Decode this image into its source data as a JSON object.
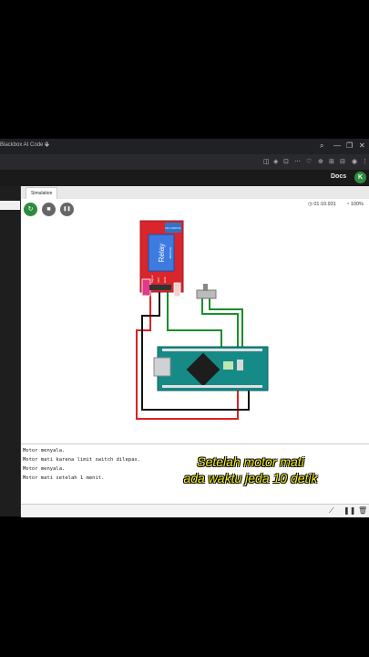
{
  "tab": {
    "title": "Blackbox AI Code G",
    "new_tab": "+"
  },
  "window_controls": {
    "search": "⌕",
    "minimize": "—",
    "restore": "❐",
    "close": "✕"
  },
  "toolbar_icons": [
    "◫",
    "◈",
    "⊡",
    "⋯",
    "♡",
    "⊕",
    "⊞",
    "⊟",
    "◉",
    "⋮"
  ],
  "app": {
    "docs_label": "Docs",
    "avatar_letter": "K"
  },
  "sim": {
    "tab_label": "Simulation",
    "timer": "01:10.931",
    "performance": "100%",
    "controls": {
      "restart": "↻",
      "stop": "■",
      "pause": "❚❚"
    }
  },
  "relay": {
    "label": "Relay",
    "sublabel": "MODULE",
    "top_pins": "NO COM NC",
    "side_pins": [
      "Signal",
      "VCC",
      "GND"
    ]
  },
  "board": {
    "name": "Arduino Nano"
  },
  "serial": {
    "lines": [
      "Motor menyala.",
      "Motor mati karena limit switch dilepas.",
      "Motor menyala.",
      "Motor mati setelah 1 menit."
    ]
  },
  "caption": [
    "Setelah motor mati",
    "ada waktu jeda 10 detik"
  ],
  "colors": {
    "accent_green": "#2e8b3e",
    "caption_yellow": "#f5ef1c",
    "relay_red": "#d8262c",
    "board_teal": "#168a87"
  }
}
